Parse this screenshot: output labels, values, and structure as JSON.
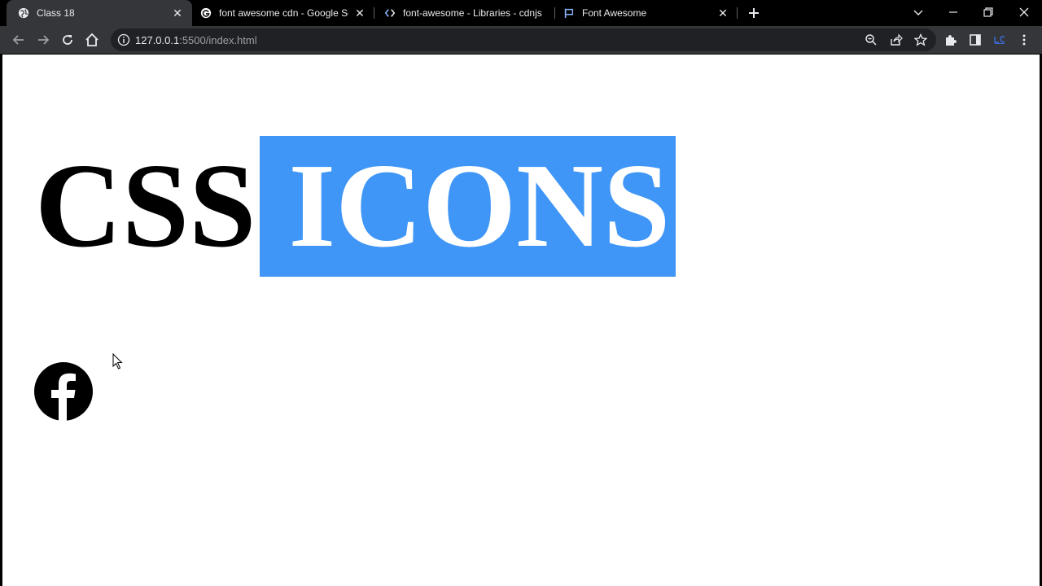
{
  "browser": {
    "tabs": [
      {
        "title": "Class 18",
        "active": true,
        "favicon": "globe-icon"
      },
      {
        "title": "font awesome cdn - Google Sear",
        "active": false,
        "favicon": "google-icon"
      },
      {
        "title": "font-awesome - Libraries - cdnjs",
        "active": false,
        "favicon": "cdnjs-icon"
      },
      {
        "title": "Font Awesome",
        "active": false,
        "favicon": "flag-icon"
      }
    ],
    "address": {
      "host": "127.0.0.1",
      "rest": ":5500/index.html"
    },
    "colors": {
      "tabstrip": "#000000",
      "toolbar": "#35363a",
      "omnibox": "#202124"
    }
  },
  "page": {
    "heading_css": "CSS",
    "heading_icons": "ICONS",
    "accent_color": "#3f96f6",
    "social_icon": "facebook-icon"
  }
}
